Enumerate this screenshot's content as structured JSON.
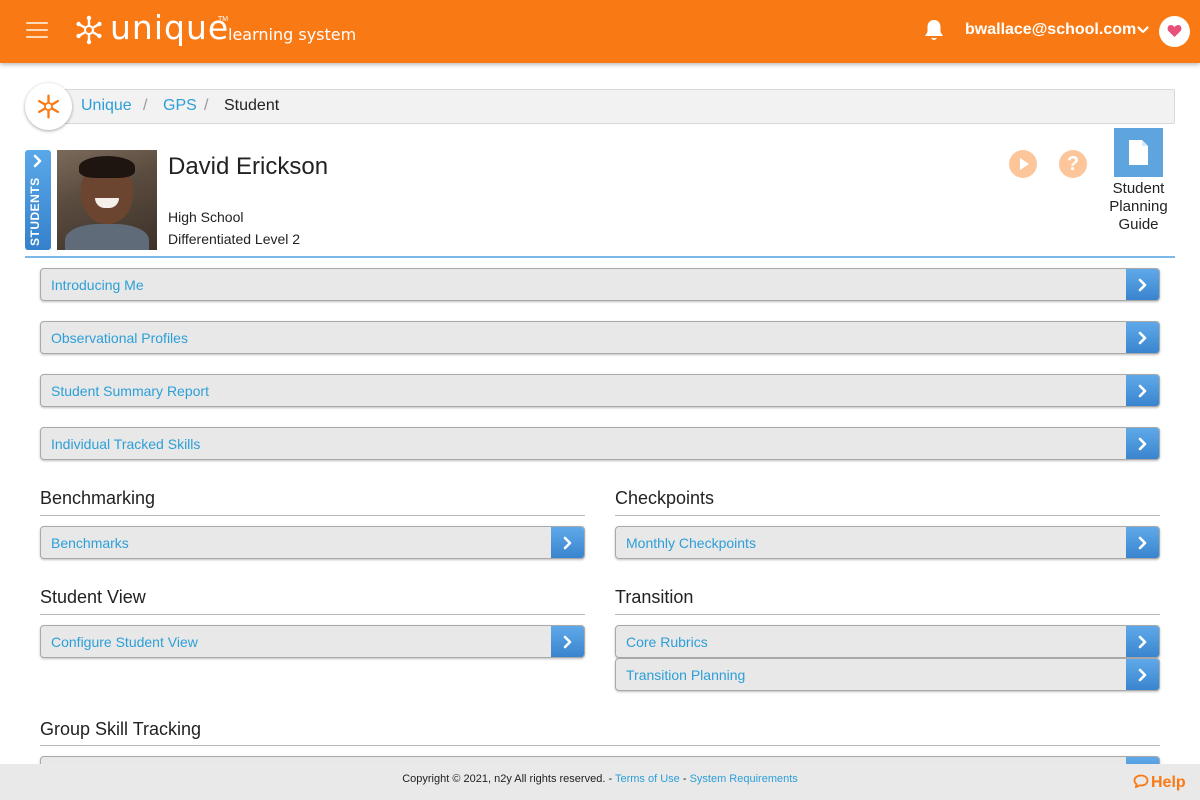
{
  "header": {
    "logo_word": "unique",
    "logo_tm": "TM",
    "logo_sub": "learning system",
    "user_email": "bwallace@school.com",
    "accent_color": "#f97a15"
  },
  "breadcrumb": {
    "items": [
      "Unique",
      "GPS",
      "Student"
    ],
    "separator": "/"
  },
  "student": {
    "tab_label": "STUDENTS",
    "name": "David Erickson",
    "school": "High School",
    "level": "Differentiated Level 2",
    "guide_label_1": "Student",
    "guide_label_2": "Planning",
    "guide_label_3": "Guide"
  },
  "main_links": [
    "Introducing Me",
    "Observational Profiles",
    "Student Summary Report",
    "Individual Tracked Skills"
  ],
  "sections": {
    "benchmarking": {
      "title": "Benchmarking",
      "items": [
        "Benchmarks"
      ]
    },
    "checkpoints": {
      "title": "Checkpoints",
      "items": [
        "Monthly Checkpoints"
      ]
    },
    "student_view": {
      "title": "Student View",
      "items": [
        "Configure Student View"
      ]
    },
    "transition": {
      "title": "Transition",
      "items": [
        "Core Rubrics",
        "Transition Planning"
      ]
    },
    "group_skill": {
      "title": "Group Skill Tracking"
    }
  },
  "footer": {
    "copyright": "Copyright © 2021, n2y All rights reserved.",
    "dash": "-",
    "terms": "Terms of Use",
    "requirements": "System Requirements",
    "help": "Help"
  },
  "icons": [
    "menu-icon",
    "snowflake-logo-icon",
    "bell-icon",
    "chevron-down-icon",
    "heart-icon",
    "play-icon",
    "help-icon",
    "document-icon",
    "chevron-right-icon",
    "chat-bubble-icon"
  ]
}
